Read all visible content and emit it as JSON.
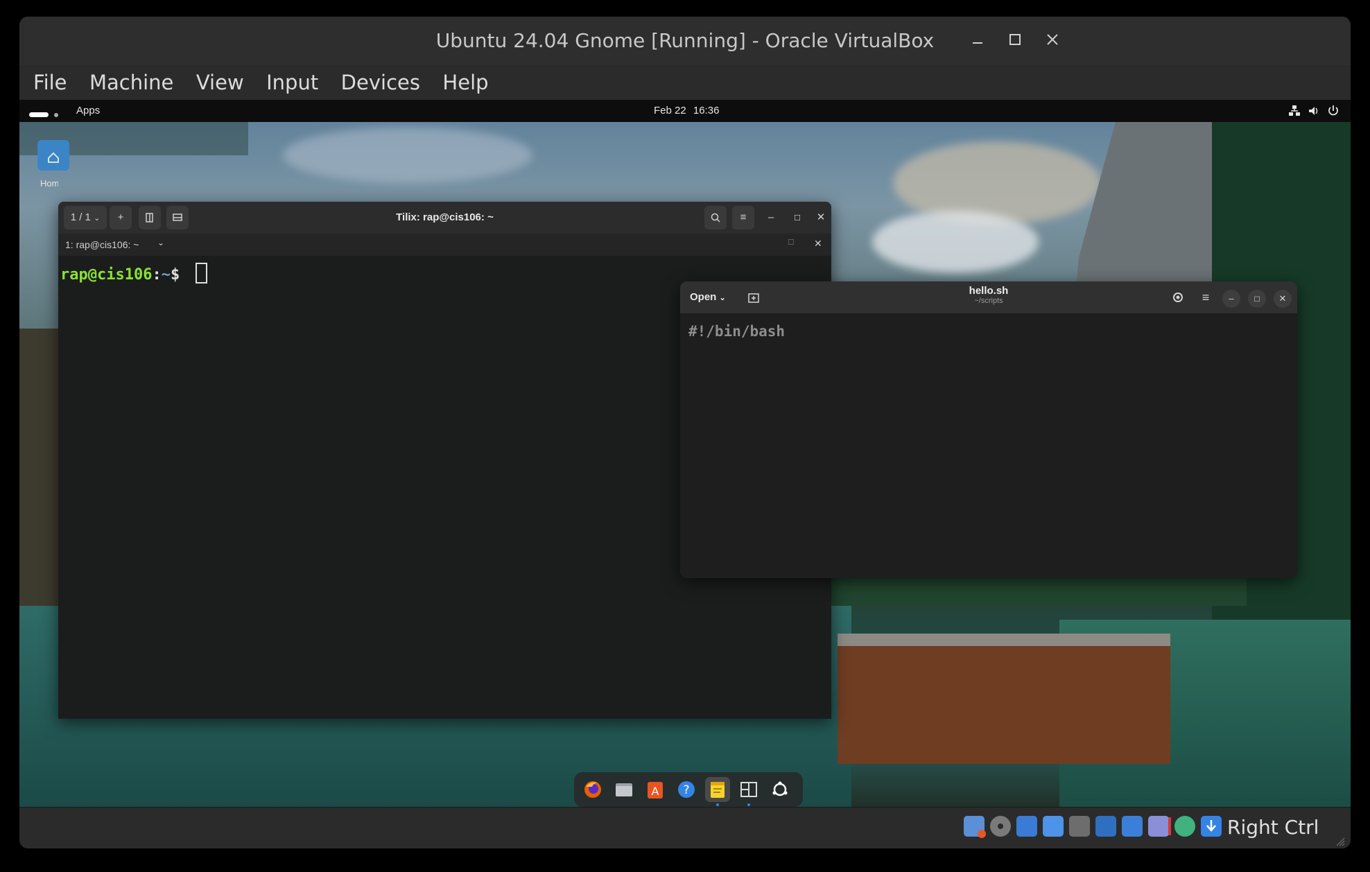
{
  "window": {
    "title": "Ubuntu 24.04 Gnome [Running] - Oracle VirtualBox",
    "controls": [
      "–",
      "☐",
      "✕"
    ]
  },
  "menu": [
    "File",
    "Machine",
    "View",
    "Input",
    "Devices",
    "Help"
  ],
  "guest_topbar": {
    "apps_label": "Apps",
    "date": "Feb 22",
    "time": "16:36"
  },
  "desktop": {
    "home_label": "Home"
  },
  "terminal": {
    "tab_counter": "1 / 1",
    "title": "Tilix: rap@cis106: ~",
    "session_label": "1: rap@cis106: ~",
    "prompt_user": "rap@cis106",
    "prompt_sep": ":",
    "prompt_path": "~",
    "prompt_symbol": "$"
  },
  "editor": {
    "open_label": "Open",
    "filename": "hello.sh",
    "path": "~/scripts",
    "content": "#!/bin/bash"
  },
  "dock": {
    "items": [
      "firefox-icon",
      "files-icon",
      "app-center-icon",
      "help-icon",
      "text-editor-icon",
      "tilix-icon",
      "show-apps-icon"
    ],
    "active": [
      "text-editor-icon",
      "tilix-icon"
    ]
  },
  "statusbar": {
    "host_key": "Right Ctrl"
  },
  "colors": {
    "prompt_green": "#8ae234",
    "prompt_blue": "#729fcf"
  }
}
